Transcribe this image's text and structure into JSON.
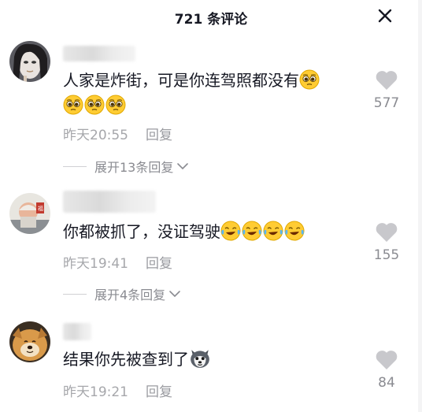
{
  "header": {
    "title": "721 条评论"
  },
  "comments": [
    {
      "text": "人家是炸街，可是你连驾照都没有",
      "emoji": "pleading-face",
      "emoji_count_inline": 1,
      "emoji_count_second_line": 3,
      "time": "昨天20:55",
      "reply_label": "回复",
      "likes": "577",
      "expand_label": "展开13条回复"
    },
    {
      "text": "你都被抓了，没证驾驶",
      "emoji": "laughing-crying-face",
      "emoji_count_inline": 4,
      "time": "昨天19:41",
      "reply_label": "回复",
      "likes": "155",
      "expand_label": "展开4条回复"
    },
    {
      "text": "结果你先被查到了",
      "emoji": "husky-face",
      "emoji_count_inline": 1,
      "time": "昨天19:21",
      "reply_label": "回复",
      "likes": "84"
    }
  ],
  "colors": {
    "text": "#161823",
    "meta": "#a6a7ab",
    "like_icon": "#c8c8cc"
  },
  "icons": [
    "close-icon",
    "heart-icon",
    "chevron-down-icon",
    "pleading-face-icon",
    "laughing-crying-face-icon",
    "husky-face-icon"
  ]
}
